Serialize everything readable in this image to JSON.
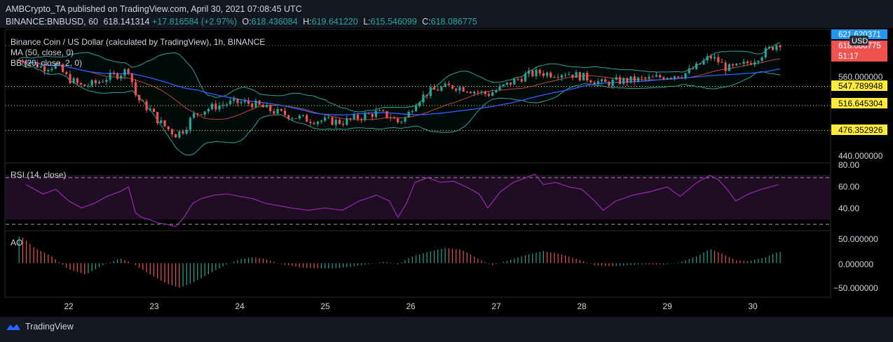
{
  "header": {
    "publisher_line": "AMBCrypto_TA published on TradingView.com, April 30, 2021 07:08:45 UTC",
    "symbol": "BINANCE:BNBUSD, 60",
    "last": "618.141314",
    "change": "+17.816584 (+2.97%)",
    "o_label": "O:",
    "o_value": "618.436084",
    "h_label": "H:",
    "h_value": "619.641220",
    "l_label": "L:",
    "l_value": "615.546099",
    "c_label": "C:",
    "c_value": "618.086775"
  },
  "legend": {
    "title": "Binance Coin / US Dollar (calculated by TradingView), 1h, BINANCE",
    "ma": "MA (50, close, 0)",
    "bb": "BB (20, close, 2, 0)",
    "rsi": "RSI (14, close)",
    "ao": "AO"
  },
  "price_axis": {
    "unit": "USD",
    "tag_top": "621.620371",
    "tag_current": "618.086775",
    "countdown": "51:17",
    "ticks": [
      "560.000000",
      "440.000000"
    ],
    "level_tags": [
      "547.789948",
      "516.645304",
      "476.352926"
    ]
  },
  "rsi_axis": {
    "ticks": [
      "80.00",
      "60.00",
      "40.00"
    ]
  },
  "ao_axis": {
    "ticks": [
      "50.000000",
      "0.000000",
      "−50.000000"
    ]
  },
  "time_axis": {
    "labels": [
      "22",
      "23",
      "24",
      "25",
      "26",
      "27",
      "28",
      "29",
      "30"
    ]
  },
  "footer": {
    "brand": "TradingView"
  },
  "colors": {
    "up": "#26a69a",
    "down": "#ef5350",
    "ma": "#2962ff",
    "bb": "#26a69a",
    "rsi": "#9c27b0",
    "rsi_band": "#1f0d24",
    "level": "#ffeb3b",
    "tag": "#ffeb3b",
    "ao_up": "#26a69a",
    "ao_down": "#ef5350"
  },
  "chart_data": [
    {
      "type": "candlestick",
      "title": "Binance Coin / US Dollar (calculated by TradingView), 1h, BINANCE",
      "x": [
        "22",
        "23",
        "24",
        "25",
        "26",
        "27",
        "28",
        "29",
        "30"
      ],
      "ylim": [
        425,
        640
      ],
      "levels": [
        547.789948,
        516.645304,
        476.352926
      ],
      "close_path": [
        [
          21.5,
          590
        ],
        [
          21.7,
          578
        ],
        [
          21.85,
          582
        ],
        [
          22.0,
          560
        ],
        [
          22.15,
          548
        ],
        [
          22.3,
          552
        ],
        [
          22.45,
          562
        ],
        [
          22.6,
          568
        ],
        [
          22.7,
          576
        ],
        [
          22.78,
          535
        ],
        [
          22.85,
          520
        ],
        [
          22.95,
          510
        ],
        [
          23.05,
          492
        ],
        [
          23.15,
          480
        ],
        [
          23.25,
          470
        ],
        [
          23.35,
          478
        ],
        [
          23.45,
          500
        ],
        [
          23.55,
          508
        ],
        [
          23.7,
          515
        ],
        [
          23.85,
          520
        ],
        [
          24.0,
          522
        ],
        [
          24.15,
          520
        ],
        [
          24.3,
          512
        ],
        [
          24.45,
          505
        ],
        [
          24.6,
          500
        ],
        [
          24.8,
          494
        ],
        [
          25.0,
          492
        ],
        [
          25.2,
          490
        ],
        [
          25.4,
          498
        ],
        [
          25.6,
          505
        ],
        [
          25.75,
          500
        ],
        [
          25.85,
          490
        ],
        [
          25.95,
          498
        ],
        [
          26.05,
          522
        ],
        [
          26.2,
          538
        ],
        [
          26.35,
          545
        ],
        [
          26.5,
          548
        ],
        [
          26.65,
          544
        ],
        [
          26.8,
          538
        ],
        [
          26.9,
          535
        ],
        [
          27.05,
          545
        ],
        [
          27.2,
          556
        ],
        [
          27.35,
          566
        ],
        [
          27.5,
          570
        ],
        [
          27.65,
          568
        ],
        [
          27.8,
          570
        ],
        [
          27.95,
          565
        ],
        [
          28.1,
          560
        ],
        [
          28.25,
          552
        ],
        [
          28.4,
          556
        ],
        [
          28.6,
          558
        ],
        [
          28.8,
          560
        ],
        [
          29.0,
          565
        ],
        [
          29.2,
          568
        ],
        [
          29.35,
          580
        ],
        [
          29.5,
          596
        ],
        [
          29.6,
          588
        ],
        [
          29.7,
          576
        ],
        [
          29.85,
          580
        ],
        [
          30.0,
          590
        ],
        [
          30.15,
          604
        ],
        [
          30.3,
          618
        ]
      ]
    },
    {
      "type": "line",
      "title": "RSI (14, close)",
      "ylim": [
        25,
        82
      ],
      "bands": [
        70,
        30
      ],
      "points": [
        [
          21.5,
          64
        ],
        [
          21.7,
          56
        ],
        [
          21.85,
          60
        ],
        [
          22.0,
          50
        ],
        [
          22.15,
          44
        ],
        [
          22.3,
          48
        ],
        [
          22.45,
          54
        ],
        [
          22.6,
          58
        ],
        [
          22.7,
          62
        ],
        [
          22.78,
          40
        ],
        [
          22.85,
          36
        ],
        [
          22.95,
          34
        ],
        [
          23.05,
          31
        ],
        [
          23.15,
          30
        ],
        [
          23.25,
          28
        ],
        [
          23.35,
          36
        ],
        [
          23.45,
          48
        ],
        [
          23.55,
          52
        ],
        [
          23.7,
          55
        ],
        [
          23.85,
          56
        ],
        [
          24.0,
          54
        ],
        [
          24.15,
          52
        ],
        [
          24.3,
          48
        ],
        [
          24.45,
          46
        ],
        [
          24.6,
          44
        ],
        [
          24.8,
          42
        ],
        [
          25.0,
          44
        ],
        [
          25.2,
          42
        ],
        [
          25.4,
          50
        ],
        [
          25.6,
          55
        ],
        [
          25.75,
          50
        ],
        [
          25.85,
          36
        ],
        [
          25.95,
          48
        ],
        [
          26.05,
          66
        ],
        [
          26.2,
          70
        ],
        [
          26.35,
          66
        ],
        [
          26.5,
          67
        ],
        [
          26.65,
          62
        ],
        [
          26.8,
          56
        ],
        [
          26.9,
          44
        ],
        [
          27.05,
          58
        ],
        [
          27.2,
          66
        ],
        [
          27.35,
          70
        ],
        [
          27.45,
          73
        ],
        [
          27.55,
          64
        ],
        [
          27.7,
          66
        ],
        [
          27.85,
          62
        ],
        [
          28.0,
          60
        ],
        [
          28.15,
          50
        ],
        [
          28.25,
          42
        ],
        [
          28.4,
          50
        ],
        [
          28.6,
          55
        ],
        [
          28.8,
          58
        ],
        [
          29.0,
          62
        ],
        [
          29.15,
          54
        ],
        [
          29.35,
          66
        ],
        [
          29.5,
          72
        ],
        [
          29.6,
          68
        ],
        [
          29.7,
          60
        ],
        [
          29.8,
          50
        ],
        [
          29.95,
          56
        ],
        [
          30.1,
          60
        ],
        [
          30.2,
          62
        ],
        [
          30.3,
          64
        ]
      ]
    },
    {
      "type": "bar",
      "title": "AO",
      "ylim": [
        -65,
        62
      ],
      "segments": [
        [
          21.45,
          52
        ],
        [
          21.6,
          30
        ],
        [
          21.8,
          14
        ],
        [
          22.0,
          -12
        ],
        [
          22.2,
          -22
        ],
        [
          22.4,
          -4
        ],
        [
          22.6,
          10
        ],
        [
          22.75,
          0
        ],
        [
          22.95,
          -22
        ],
        [
          23.15,
          -40
        ],
        [
          23.3,
          -48
        ],
        [
          23.45,
          -38
        ],
        [
          23.65,
          -20
        ],
        [
          23.85,
          -2
        ],
        [
          24.0,
          8
        ],
        [
          24.15,
          12
        ],
        [
          24.3,
          8
        ],
        [
          24.5,
          -2
        ],
        [
          24.7,
          -8
        ],
        [
          24.9,
          -10
        ],
        [
          25.1,
          -10
        ],
        [
          25.3,
          -7
        ],
        [
          25.5,
          -2
        ],
        [
          25.7,
          3
        ],
        [
          25.85,
          -2
        ],
        [
          26.0,
          12
        ],
        [
          26.2,
          22
        ],
        [
          26.4,
          30
        ],
        [
          26.6,
          26
        ],
        [
          26.8,
          8
        ],
        [
          26.95,
          -4
        ],
        [
          27.15,
          6
        ],
        [
          27.35,
          16
        ],
        [
          27.55,
          24
        ],
        [
          27.75,
          18
        ],
        [
          27.95,
          8
        ],
        [
          28.15,
          -4
        ],
        [
          28.35,
          -6
        ],
        [
          28.55,
          -4
        ],
        [
          28.75,
          -2
        ],
        [
          28.95,
          -3
        ],
        [
          29.15,
          2
        ],
        [
          29.35,
          14
        ],
        [
          29.5,
          28
        ],
        [
          29.65,
          18
        ],
        [
          29.8,
          6
        ],
        [
          29.95,
          4
        ],
        [
          30.15,
          12
        ],
        [
          30.3,
          22
        ]
      ]
    }
  ]
}
